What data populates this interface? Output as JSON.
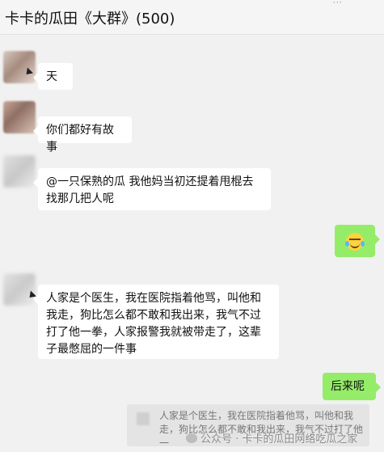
{
  "header": {
    "title": "卡卡的瓜田《大群》(500)",
    "more_icon": "ellipsis-icon"
  },
  "messages": [
    {
      "side": "left",
      "text": "天"
    },
    {
      "side": "left",
      "text": "你们都好有故事"
    },
    {
      "side": "left",
      "text": "@一只保熟的瓜 我他妈当初还提着甩棍去找那几把人呢"
    },
    {
      "side": "right",
      "emoji": "laughing-tears-emoji"
    },
    {
      "side": "left",
      "text": "人家是个医生，我在医院指着他骂，叫他和我走，狗比怎么都不敢和我出来，我气不过打了他一拳，人家报警我就被带走了，这辈子最憋屈的一件事"
    },
    {
      "side": "right",
      "text": "后来呢"
    }
  ],
  "quote": {
    "text": "人家是个医生，我在医院指着他骂，叫他和我走，狗比怎么都不敢和我出来，我气不过打了他一"
  },
  "watermark": {
    "text": "公众号 · 卡卡的瓜田网络吃瓜之家"
  },
  "colors": {
    "background": "#f1f1f1",
    "bubble_left": "#ffffff",
    "bubble_right": "#95ec69"
  }
}
